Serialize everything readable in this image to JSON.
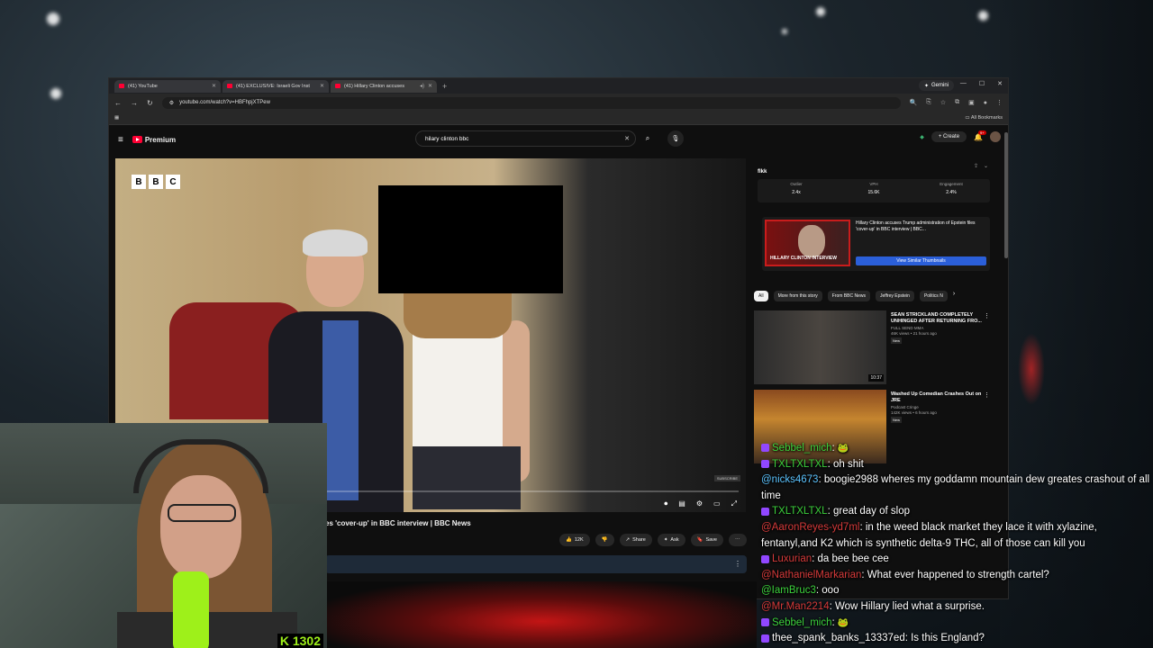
{
  "browser": {
    "tabs": [
      {
        "title": "(41) YouTube",
        "active": false
      },
      {
        "title": "(41) EXCLUSIVE: Israeli Gov Inst",
        "active": false
      },
      {
        "title": "(41) Hillary Clinton accuses",
        "active": true
      }
    ],
    "gemini_label": "Gemini",
    "url": "youtube.com/watch?v=HBFhpjXTPew",
    "all_bookmarks": "All Bookmarks"
  },
  "youtube": {
    "logo_text": "Premium",
    "search_value": "hilary clinton bbc",
    "create_label": "Create",
    "notif_count": "9+"
  },
  "video": {
    "watermark": [
      "B",
      "B",
      "C"
    ],
    "progress": 0.0,
    "title": "es 'cover-up' in BBC interview | BBC News",
    "likes": "12K",
    "share_label": "Share",
    "ask_label": "Ask",
    "save_label": "Save"
  },
  "extension": {
    "logo": "flkk",
    "metrics": [
      {
        "label": "Outlier",
        "value": "2.4x"
      },
      {
        "label": "VPH",
        "value": "15.6K"
      },
      {
        "label": "Engagement",
        "value": "2.4%"
      }
    ],
    "thumb_label": "HILLARY CLINTON INTERVIEW",
    "thumb_title": "Hillary Clinton accuses Trump administration of Epstein files 'cover-up' in BBC interview | BBC...",
    "similar_button": "View Similar Thumbnails"
  },
  "chips": [
    "All",
    "More from this story",
    "From BBC News",
    "Jeffrey Epstein",
    "Politics N"
  ],
  "recommendations": [
    {
      "title": "SEAN STRICKLAND COMPLETELY UNHINGED AFTER RETURNING FRO...",
      "channel": "FULL SEND MMA",
      "meta": "46K views • 21 hours ago",
      "badge": "New",
      "duration": "10:37"
    },
    {
      "title": "Washed Up Comedian Crashes Out on JRE",
      "channel": "Podcast Cringe",
      "meta": "142K views • 6 hours ago",
      "badge": "New",
      "duration": ""
    }
  ],
  "stream": {
    "counter": "K 1302"
  },
  "chat": [
    {
      "user": "Sebbel_mich",
      "color": "#3cd13c",
      "text": "",
      "emote": "🐸",
      "badge": true
    },
    {
      "user": "TXLTXLTXL",
      "color": "#3cd13c",
      "text": "oh shit",
      "emote": "",
      "badge": true
    },
    {
      "user": "@nicks4673",
      "color": "#5cc4ff",
      "text": "boogie2988 wheres my goddamn mountain dew greates crashout of all time",
      "emote": "",
      "badge": false
    },
    {
      "user": "TXLTXLTXL",
      "color": "#3cd13c",
      "text": "great day of slop",
      "emote": "",
      "badge": true
    },
    {
      "user": "@AaronReyes-yd7ml",
      "color": "#d63a3a",
      "text": "in the weed black market they lace it with xylazine, fentanyl,and K2 which is synthetic delta-9 THC, all of those can kill you",
      "emote": "",
      "badge": false
    },
    {
      "user": "Luxurian",
      "color": "#d63a3a",
      "text": "da bee bee cee",
      "emote": "",
      "badge": true
    },
    {
      "user": "@NathanielMarkarian",
      "color": "#d63a3a",
      "text": "What ever happened to strength cartel?",
      "emote": "",
      "badge": false
    },
    {
      "user": "@IamBruc3",
      "color": "#3cd13c",
      "text": "ooo",
      "emote": "",
      "badge": false
    },
    {
      "user": "@Mr.Man2214",
      "color": "#d63a3a",
      "text": "Wow Hillary lied what a surprise.",
      "emote": "",
      "badge": false
    },
    {
      "user": "Sebbel_mich",
      "color": "#3cd13c",
      "text": "",
      "emote": "🐸",
      "badge": true
    },
    {
      "user": "thee_spank_banks_13337ed",
      "color": "#ffffff",
      "text": "Is this England?",
      "emote": "",
      "badge": true
    }
  ]
}
